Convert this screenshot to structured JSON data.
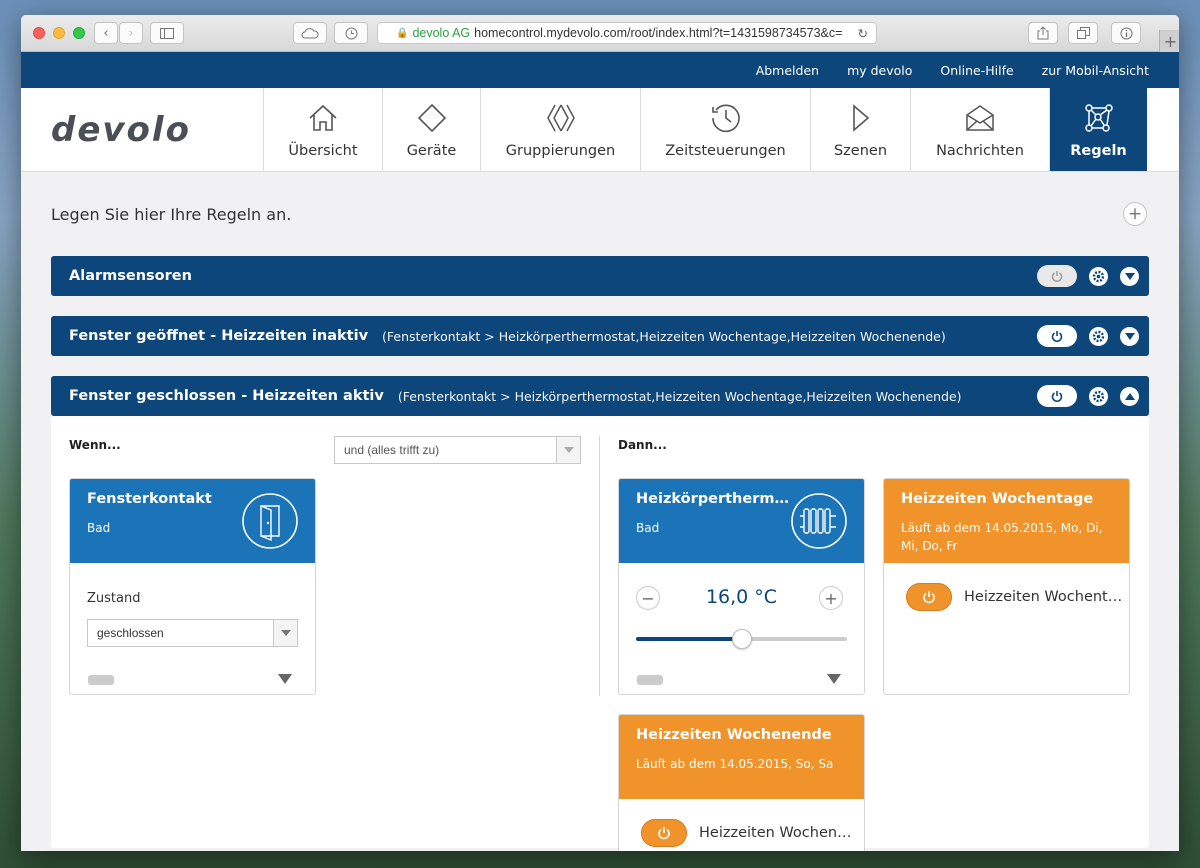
{
  "browser": {
    "url_org": "devolo AG",
    "url_text": "homecontrol.mydevolo.com/root/index.html?t=1431598734573&c="
  },
  "topbar": {
    "links": [
      "Abmelden",
      "my devolo",
      "Online-Hilfe",
      "zur Mobil-Ansicht"
    ]
  },
  "nav": {
    "logo": "devolo",
    "items": [
      {
        "label": "Übersicht",
        "icon": "home-icon"
      },
      {
        "label": "Geräte",
        "icon": "diamond-icon"
      },
      {
        "label": "Gruppierungen",
        "icon": "group-icon"
      },
      {
        "label": "Zeitsteuerungen",
        "icon": "clock-icon"
      },
      {
        "label": "Szenen",
        "icon": "play-icon"
      },
      {
        "label": "Nachrichten",
        "icon": "envelope-icon"
      },
      {
        "label": "Regeln",
        "icon": "rules-icon"
      }
    ],
    "active": "Regeln"
  },
  "intro": "Legen Sie hier Ihre Regeln an.",
  "rules": [
    {
      "title": "Alarmsensoren",
      "desc": "",
      "state": "off",
      "expanded": false
    },
    {
      "title": "Fenster geöffnet - Heizzeiten inaktiv",
      "desc": "(Fensterkontakt > Heizkörperthermostat,Heizzeiten Wochentage,Heizzeiten Wochenende)",
      "state": "on",
      "expanded": false
    },
    {
      "title": "Fenster geschlossen - Heizzeiten aktiv",
      "desc": "(Fensterkontakt > Heizkörperthermostat,Heizzeiten Wochentage,Heizzeiten Wochenende)",
      "state": "on",
      "expanded": true
    }
  ],
  "expanded_rule": {
    "when_label": "Wenn...",
    "condition_select": "und (alles trifft zu)",
    "then_label": "Dann...",
    "trigger_card": {
      "title": "Fensterkontakt",
      "subtitle": "Bad",
      "field_label": "Zustand",
      "field_value": "geschlossen"
    },
    "thermostat_card": {
      "title": "Heizkörpertherm…",
      "subtitle": "Bad",
      "temperature": "16,0 °C",
      "slider_fraction": 0.5
    },
    "weekdays_card": {
      "title": "Heizzeiten Wochentage",
      "subtitle": "Läuft ab dem 14.05.2015, Mo, Di, Mi, Do, Fr",
      "toggle_label": "Heizzeiten Wochent…"
    },
    "weekend_card": {
      "title": "Heizzeiten Wochenende",
      "subtitle": "Läuft ab dem 14.05.2015, So, Sa",
      "toggle_label": "Heizzeiten Wochen…"
    }
  },
  "colors": {
    "brand_blue": "#0d467a",
    "card_blue": "#1b73b8",
    "orange": "#f0932b"
  }
}
